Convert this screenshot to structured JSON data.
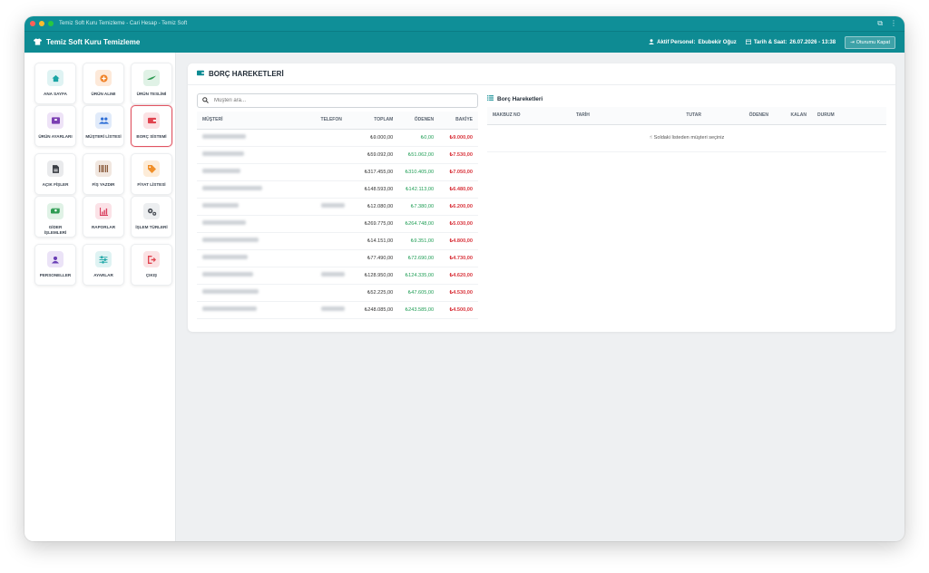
{
  "window": {
    "title": "Temiz Soft Kuru Temizleme - Cari Hesap - Temiz Soft"
  },
  "header": {
    "app_title": "Temiz Soft Kuru Temizleme",
    "personnel_label": "Aktif Personel:",
    "personnel_name": "Ebubekir Oğuz",
    "datetime_label": "Tarih & Saat:",
    "datetime_value": "26.07.2026 - 13:38",
    "logout_label": "Oturumu Kapat"
  },
  "sidebar": {
    "items": [
      {
        "label": "ANA SAYFA",
        "icon": "home-icon",
        "color": "#1aa5a5",
        "bg": "#dff3f3"
      },
      {
        "label": "ÜRÜN ALIMI",
        "icon": "plus-circle-icon",
        "color": "#f0832a",
        "bg": "#fde9d9"
      },
      {
        "label": "ÜRÜN TESLİMİ",
        "icon": "leaf-icon",
        "color": "#2e9b52",
        "bg": "#e0f2e6"
      },
      {
        "label": "ÜRÜN AYARLARI",
        "icon": "box-icon",
        "color": "#7b3fb3",
        "bg": "#eee3f7"
      },
      {
        "label": "MÜŞTERİ LİSTESİ",
        "icon": "users-icon",
        "color": "#2f6fd6",
        "bg": "#e1ebfa"
      },
      {
        "label": "BORÇ SİSTEMİ",
        "icon": "wallet-icon",
        "color": "#e0444f",
        "bg": "#fbe2e4"
      },
      {
        "label": "AÇIK FİŞLER",
        "icon": "file-icon",
        "color": "#3b3f46",
        "bg": "#e9eaec"
      },
      {
        "label": "FİŞ YAZDIR",
        "icon": "barcode-icon",
        "color": "#8a5a3b",
        "bg": "#f1e7e0"
      },
      {
        "label": "FİYAT LİSTESİ",
        "icon": "tag-icon",
        "color": "#f0902a",
        "bg": "#fdecd8"
      },
      {
        "label": "GİDER İŞLEMLERİ",
        "icon": "money-icon",
        "color": "#2e9b52",
        "bg": "#e0f2e6"
      },
      {
        "label": "RAPORLAR",
        "icon": "chart-icon",
        "color": "#d93a5a",
        "bg": "#fbe2e7"
      },
      {
        "label": "İŞLEM TÜRLERİ",
        "icon": "gears-icon",
        "color": "#4a4f57",
        "bg": "#eceef0"
      },
      {
        "label": "PERSONELLER",
        "icon": "user-icon",
        "color": "#6a3fb5",
        "bg": "#ebe3f7"
      },
      {
        "label": "AYARLAR",
        "icon": "sliders-icon",
        "color": "#1aa5a5",
        "bg": "#dff3f3"
      },
      {
        "label": "ÇIKIŞ",
        "icon": "exit-icon",
        "color": "#e0444f",
        "bg": "#fbe2e4"
      }
    ]
  },
  "main": {
    "title": "BORÇ HAREKETLERİ",
    "search_placeholder": "Müşteri ara...",
    "columns": [
      "MÜŞTERİ",
      "TELEFON",
      "TOPLAM",
      "ÖDENEN",
      "BAKİYE"
    ],
    "rows": [
      {
        "toplam": "₺9.000,00",
        "odenen": "₺0,00",
        "bakiye": "₺9.000,00"
      },
      {
        "toplam": "₺59.092,00",
        "odenen": "₺51.062,00",
        "bakiye": "₺7.530,00"
      },
      {
        "toplam": "₺317.455,00",
        "odenen": "₺310.405,00",
        "bakiye": "₺7.050,00"
      },
      {
        "toplam": "₺148.593,00",
        "odenen": "₺142.113,00",
        "bakiye": "₺6.480,00"
      },
      {
        "toplam": "₺12.080,00",
        "odenen": "₺7.380,00",
        "bakiye": "₺6.200,00"
      },
      {
        "toplam": "₺269.775,00",
        "odenen": "₺264.748,00",
        "bakiye": "₺5.030,00"
      },
      {
        "toplam": "₺14.151,00",
        "odenen": "₺9.351,00",
        "bakiye": "₺4.800,00"
      },
      {
        "toplam": "₺77.490,00",
        "odenen": "₺72.690,00",
        "bakiye": "₺4.730,00"
      },
      {
        "toplam": "₺128.950,00",
        "odenen": "₺124.335,00",
        "bakiye": "₺4.620,00"
      },
      {
        "toplam": "₺52.225,00",
        "odenen": "₺47.605,00",
        "bakiye": "₺4.530,00"
      },
      {
        "toplam": "₺248.085,00",
        "odenen": "₺243.585,00",
        "bakiye": "₺4.500,00"
      }
    ],
    "right": {
      "title": "Borç Hareketleri",
      "columns": [
        "MAKBUZ NO",
        "TARİH",
        "TUTAR",
        "ÖDENEN",
        "KALAN",
        "DURUM"
      ],
      "empty_message": "Soldaki listeden müşteri seçiniz"
    }
  }
}
